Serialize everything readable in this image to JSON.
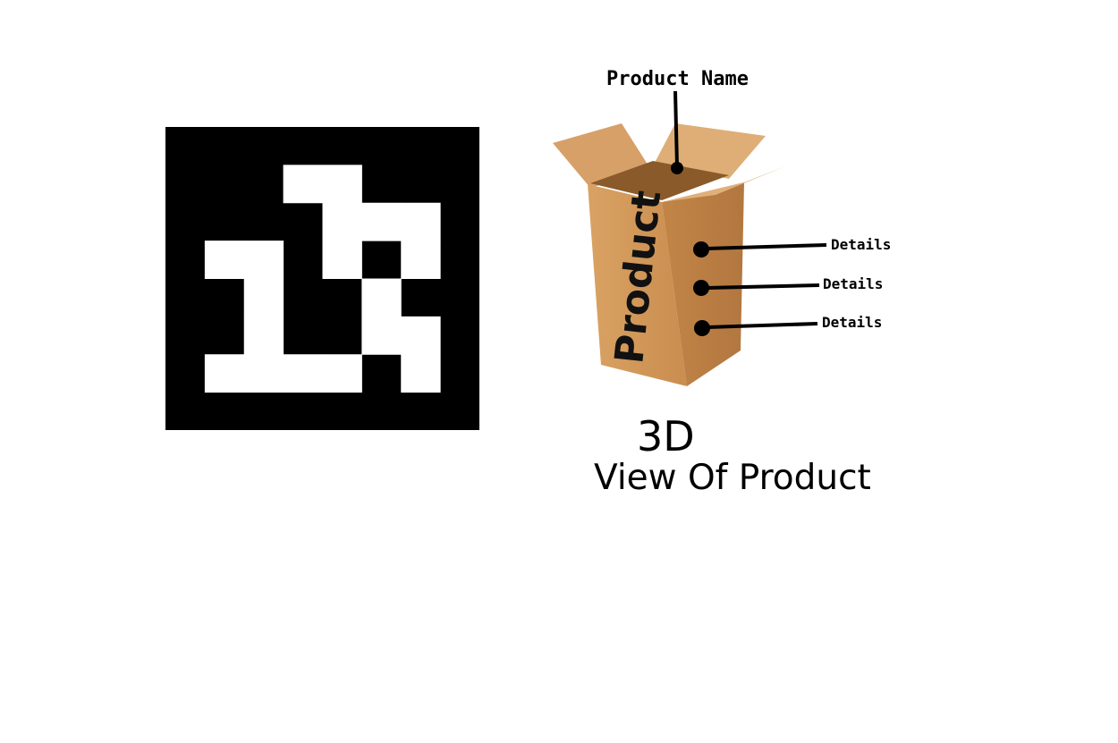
{
  "marker": {
    "grid": [
      [
        0,
        0,
        0,
        0,
        0,
        0,
        0,
        0
      ],
      [
        0,
        0,
        0,
        1,
        1,
        0,
        0,
        0
      ],
      [
        0,
        0,
        0,
        0,
        1,
        1,
        1,
        0
      ],
      [
        0,
        1,
        1,
        0,
        1,
        0,
        1,
        0
      ],
      [
        0,
        0,
        1,
        0,
        0,
        1,
        0,
        0
      ],
      [
        0,
        0,
        1,
        0,
        0,
        1,
        1,
        0
      ],
      [
        0,
        1,
        1,
        1,
        1,
        0,
        1,
        0
      ],
      [
        0,
        0,
        0,
        0,
        0,
        0,
        0,
        0
      ]
    ],
    "dark_color": "#000000",
    "light_color": "#ffffff"
  },
  "box": {
    "side_text": "Product",
    "color_main": "#d29a5c",
    "color_light": "#e3b37a",
    "color_dark": "#a86f38",
    "color_inside": "#8a5a2b"
  },
  "callouts": {
    "product_name": "Product Name",
    "details": [
      "Details",
      "Details",
      "Details"
    ]
  },
  "caption": {
    "line1": "3D",
    "line2": "View Of Product"
  }
}
